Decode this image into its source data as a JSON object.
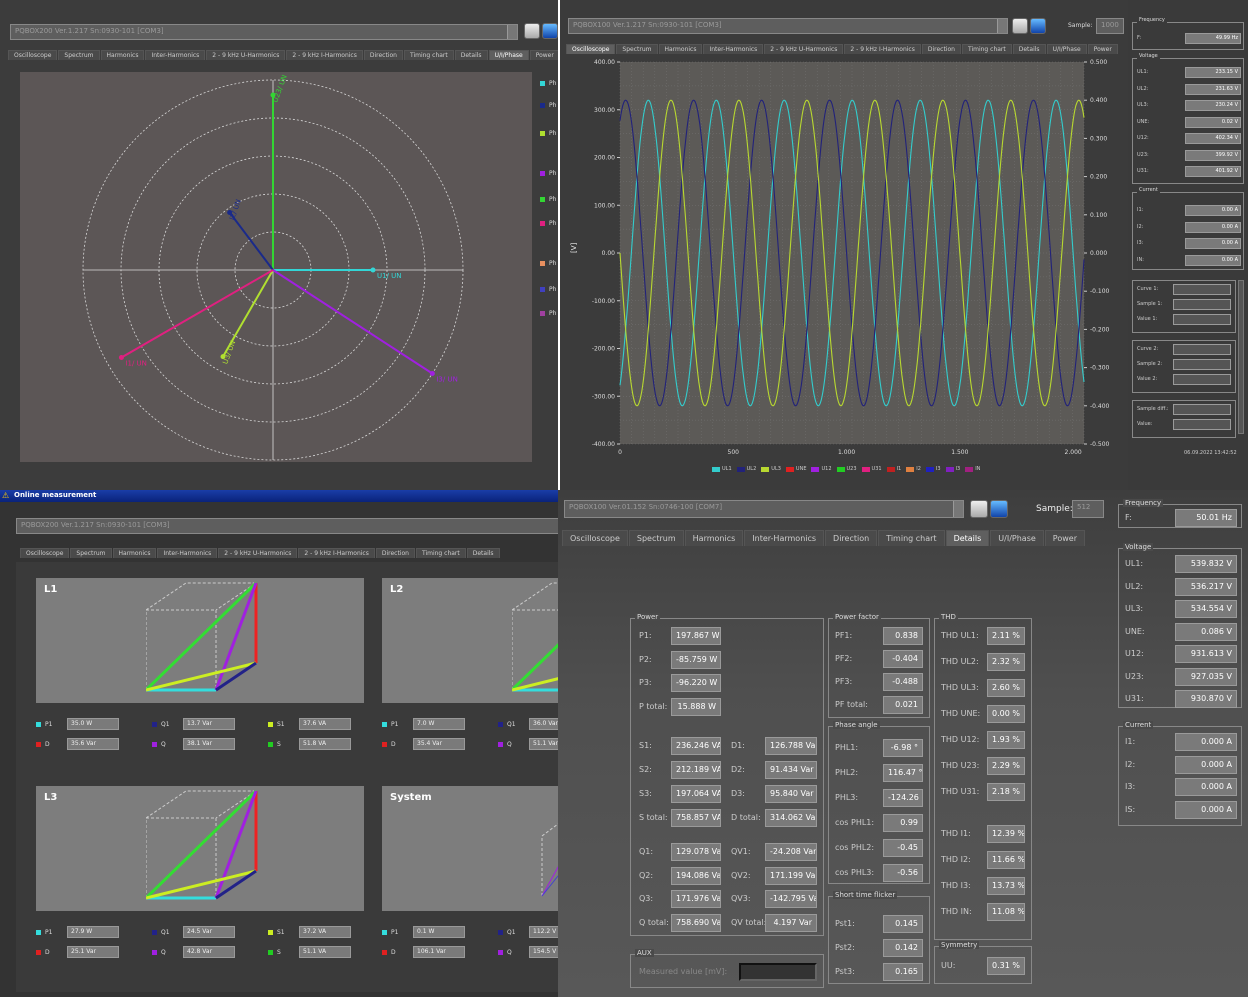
{
  "p1": {
    "combo": "PQBOX200 Ver.1.217 Sn:0930-101 [COM3]",
    "tabs": [
      "Oscilloscope",
      "Spectrum",
      "Harmonics",
      "Inter-Harmonics",
      "2 - 9 kHz U-Harmonics",
      "2 - 9 kHz I-Harmonics",
      "Direction",
      "Timing chart",
      "Details",
      "U/I/Phase",
      "Power"
    ],
    "vector_labels": [
      "U23/ UN",
      "U1/ UN",
      "U3/ UN",
      "I2/ UN",
      "I3/ UN",
      "I1/ UN"
    ],
    "legend": [
      "Ph",
      "Ph",
      "Ph",
      "Ph",
      "Ph",
      "Ph",
      "Ph",
      "Ph",
      "Ph"
    ],
    "colors": {
      "u1": "#33d6d6",
      "u2": "#33d633",
      "u3": "#b0e030",
      "i1": "#1a2a8a",
      "i2": "#a020e0",
      "i3": "#e02080"
    }
  },
  "p2": {
    "combo": "PQBOX100 Ver.1.217 Sn:0930-101 [COM3]",
    "sample_label": "Sample:",
    "sample_value": "1000",
    "tabs": [
      "Oscilloscope",
      "Spectrum",
      "Harmonics",
      "Inter-Harmonics",
      "2 - 9 kHz U-Harmonics",
      "2 - 9 kHz I-Harmonics",
      "Direction",
      "Timing chart",
      "Details",
      "U/I/Phase",
      "Power"
    ],
    "side": {
      "frequency_title": "Frequency",
      "f_label": "F:",
      "f_value": "49.99 Hz",
      "voltage_title": "Voltage",
      "voltage": [
        {
          "label": "UL1:",
          "value": "233.15 V"
        },
        {
          "label": "UL2:",
          "value": "231.63 V"
        },
        {
          "label": "UL3:",
          "value": "230.24 V"
        },
        {
          "label": "UNE:",
          "value": "0.02 V"
        },
        {
          "label": "U12:",
          "value": "402.34 V"
        },
        {
          "label": "U23:",
          "value": "399.92 V"
        },
        {
          "label": "U31:",
          "value": "401.92 V"
        }
      ],
      "current_title": "Current",
      "current": [
        {
          "label": "I1:",
          "value": "0.00 A"
        },
        {
          "label": "I2:",
          "value": "0.00 A"
        },
        {
          "label": "I3:",
          "value": "0.00 A"
        },
        {
          "label": "IN:",
          "value": "0.00 A"
        }
      ],
      "cursor1": [
        "Curve 1:",
        "Sample 1:",
        "Value 1:"
      ],
      "cursor2": [
        "Curve 2:",
        "Sample 2:",
        "Value 2:"
      ],
      "diff": [
        "Sample diff.:",
        "Value:"
      ],
      "timestamp": "06.09.2022 13:42:52"
    }
  },
  "p3": {
    "title": "Online measurement",
    "combo": "PQBOX200 Ver.1.217 Sn:0930-101 [COM3]",
    "tabs": [
      "Oscilloscope",
      "Spectrum",
      "Harmonics",
      "Inter-Harmonics",
      "2 - 9 kHz U-Harmonics",
      "2 - 9 kHz I-Harmonics",
      "Direction",
      "Timing chart",
      "Details"
    ],
    "boxes": [
      {
        "title": "L1",
        "vals": [
          {
            "k": "P1",
            "v": "35.0 W"
          },
          {
            "k": "Q1",
            "v": "13.7 Var"
          },
          {
            "k": "S1",
            "v": "37.6 VA"
          },
          {
            "k": "D",
            "v": "35.6 Var"
          },
          {
            "k": "Q",
            "v": "38.1 Var"
          },
          {
            "k": "S",
            "v": "51.8 VA"
          }
        ]
      },
      {
        "title": "L2",
        "vals": [
          {
            "k": "P1",
            "v": "7.0 W"
          },
          {
            "k": "Q1",
            "v": "36.0 Var"
          },
          {
            "k": "D",
            "v": "35.4 Var"
          },
          {
            "k": "Q",
            "v": "51.1 Var"
          }
        ]
      },
      {
        "title": "L3",
        "vals": [
          {
            "k": "P1",
            "v": "27.9 W"
          },
          {
            "k": "Q1",
            "v": "24.5 Var"
          },
          {
            "k": "S1",
            "v": "37.2 VA"
          },
          {
            "k": "D",
            "v": "25.1 Var"
          },
          {
            "k": "Q",
            "v": "42.8 Var"
          },
          {
            "k": "S",
            "v": "51.1 VA"
          }
        ]
      },
      {
        "title": "System",
        "vals": [
          {
            "k": "P1",
            "v": "0.1 W"
          },
          {
            "k": "Q1",
            "v": "112.2 V"
          },
          {
            "k": "D",
            "v": "106.1 Var"
          },
          {
            "k": "Q",
            "v": "154.5 V"
          }
        ]
      }
    ]
  },
  "p4": {
    "combo": "PQBOX100 Ver.01.152 Sn:0746-100 [COM7]",
    "sample_label": "Sample:",
    "sample_value": "512",
    "tabs": [
      "Oscilloscope",
      "Spectrum",
      "Harmonics",
      "Inter-Harmonics",
      "Direction",
      "Timing chart",
      "Details",
      "U/I/Phase",
      "Power"
    ],
    "power_title": "Power",
    "power_p": [
      {
        "label": "P1:",
        "value": "197.867 W"
      },
      {
        "label": "P2:",
        "value": "-85.759 W"
      },
      {
        "label": "P3:",
        "value": "-96.220 W"
      },
      {
        "label": "P total:",
        "value": "15.888 W"
      }
    ],
    "power_s": [
      {
        "label": "S1:",
        "value": "236.246 VA"
      },
      {
        "label": "S2:",
        "value": "212.189 VA"
      },
      {
        "label": "S3:",
        "value": "197.064 VA"
      },
      {
        "label": "S total:",
        "value": "758.857 VA"
      }
    ],
    "power_d": [
      {
        "label": "D1:",
        "value": "126.788 Var"
      },
      {
        "label": "D2:",
        "value": "91.434 Var"
      },
      {
        "label": "D3:",
        "value": "95.840 Var"
      },
      {
        "label": "D total:",
        "value": "314.062 Var"
      }
    ],
    "power_q": [
      {
        "label": "Q1:",
        "value": "129.078 Var"
      },
      {
        "label": "Q2:",
        "value": "194.086 Var"
      },
      {
        "label": "Q3:",
        "value": "171.976 Var"
      },
      {
        "label": "Q total:",
        "value": "758.690 Var"
      }
    ],
    "power_qv": [
      {
        "label": "QV1:",
        "value": "-24.208 Var"
      },
      {
        "label": "QV2:",
        "value": "171.199 Var"
      },
      {
        "label": "QV3:",
        "value": "-142.795 Var"
      },
      {
        "label": "QV total:",
        "value": "4.197 Var"
      }
    ],
    "aux_title": "AUX",
    "aux_label": "Measured value [mV]:",
    "pf_title": "Power factor",
    "pf": [
      {
        "label": "PF1:",
        "value": "0.838"
      },
      {
        "label": "PF2:",
        "value": "-0.404"
      },
      {
        "label": "PF3:",
        "value": "-0.488"
      },
      {
        "label": "PF total:",
        "value": "0.021"
      }
    ],
    "pa_title": "Phase angle",
    "pa": [
      {
        "label": "PHL1:",
        "value": "-6.98 °"
      },
      {
        "label": "PHL2:",
        "value": "116.47 °"
      },
      {
        "label": "PHL3:",
        "value": "-124.26 °"
      },
      {
        "label": "cos PHL1:",
        "value": "0.99"
      },
      {
        "label": "cos PHL2:",
        "value": "-0.45"
      },
      {
        "label": "cos PHL3:",
        "value": "-0.56"
      }
    ],
    "flick_title": "Short time flicker",
    "flick": [
      {
        "label": "Pst1:",
        "value": "0.145"
      },
      {
        "label": "Pst2:",
        "value": "0.142"
      },
      {
        "label": "Pst3:",
        "value": "0.165"
      }
    ],
    "thd_title": "THD",
    "thd_u": [
      {
        "label": "THD UL1:",
        "value": "2.11 %"
      },
      {
        "label": "THD UL2:",
        "value": "2.32 %"
      },
      {
        "label": "THD UL3:",
        "value": "2.60 %"
      },
      {
        "label": "THD UNE:",
        "value": "0.00 %"
      },
      {
        "label": "THD U12:",
        "value": "1.93 %"
      },
      {
        "label": "THD U23:",
        "value": "2.29 %"
      },
      {
        "label": "THD U31:",
        "value": "2.18 %"
      }
    ],
    "thd_i": [
      {
        "label": "THD I1:",
        "value": "12.39 %"
      },
      {
        "label": "THD I2:",
        "value": "11.66 %"
      },
      {
        "label": "THD I3:",
        "value": "13.73 %"
      },
      {
        "label": "THD IN:",
        "value": "11.08 %"
      }
    ],
    "sym_title": "Symmetry",
    "sym_label": "UU:",
    "sym_value": "0.31 %",
    "freq_title": "Frequency",
    "f_label": "F:",
    "f_value": "50.01 Hz",
    "volt_title": "Voltage",
    "volt": [
      {
        "label": "UL1:",
        "value": "539.832 V"
      },
      {
        "label": "UL2:",
        "value": "536.217 V"
      },
      {
        "label": "UL3:",
        "value": "534.554 V"
      },
      {
        "label": "UNE:",
        "value": "0.086 V"
      },
      {
        "label": "U12:",
        "value": "931.613 V"
      },
      {
        "label": "U23:",
        "value": "927.035 V"
      },
      {
        "label": "U31:",
        "value": "930.870 V"
      }
    ],
    "curr_title": "Current",
    "curr": [
      {
        "label": "I1:",
        "value": "0.000 A"
      },
      {
        "label": "I2:",
        "value": "0.000 A"
      },
      {
        "label": "I3:",
        "value": "0.000 A"
      },
      {
        "label": "IS:",
        "value": "0.000 A"
      }
    ]
  },
  "chart_data": {
    "type": "line",
    "xlabel": "",
    "ylabel": "[V]",
    "y2label": "[A]",
    "xlim": [
      0,
      2048
    ],
    "ylim": [
      -400,
      400
    ],
    "y2lim": [
      -0.5,
      0.5
    ],
    "xticks": [
      "0",
      "500",
      "1.000",
      "1.500",
      "2.000"
    ],
    "yticks": [
      "400.00",
      "300.00",
      "200.00",
      "100.00",
      "0.00",
      "-100.00",
      "-200.00",
      "-300.00",
      "-400.00"
    ],
    "y2ticks": [
      "0.500",
      "0.400",
      "0.300",
      "0.200",
      "0.100",
      "0.000",
      "-0.100",
      "-0.200",
      "-0.300",
      "-0.400",
      "-0.500"
    ],
    "period_samples": 300,
    "amplitude": 320,
    "series": [
      {
        "name": "UL1",
        "color": "#33cccc",
        "phase_deg": -60
      },
      {
        "name": "UL2",
        "color": "#22227a",
        "phase_deg": 60
      },
      {
        "name": "UL3",
        "color": "#b8d830",
        "phase_deg": 180
      }
    ],
    "legend": [
      {
        "name": "UL1",
        "color": "#33cccc"
      },
      {
        "name": "UL2",
        "color": "#22227a"
      },
      {
        "name": "UL3",
        "color": "#b8d830"
      },
      {
        "name": "UNE",
        "color": "#e02020"
      },
      {
        "name": "U12",
        "color": "#a020e0"
      },
      {
        "name": "U23",
        "color": "#22cc22"
      },
      {
        "name": "U31",
        "color": "#e02080"
      },
      {
        "name": "I1",
        "color": "#c02020"
      },
      {
        "name": "I2",
        "color": "#e08040"
      },
      {
        "name": "I3",
        "color": "#2020c0"
      },
      {
        "name": "I3",
        "color": "#8020c0"
      },
      {
        "name": "IN",
        "color": "#a02080"
      }
    ]
  }
}
